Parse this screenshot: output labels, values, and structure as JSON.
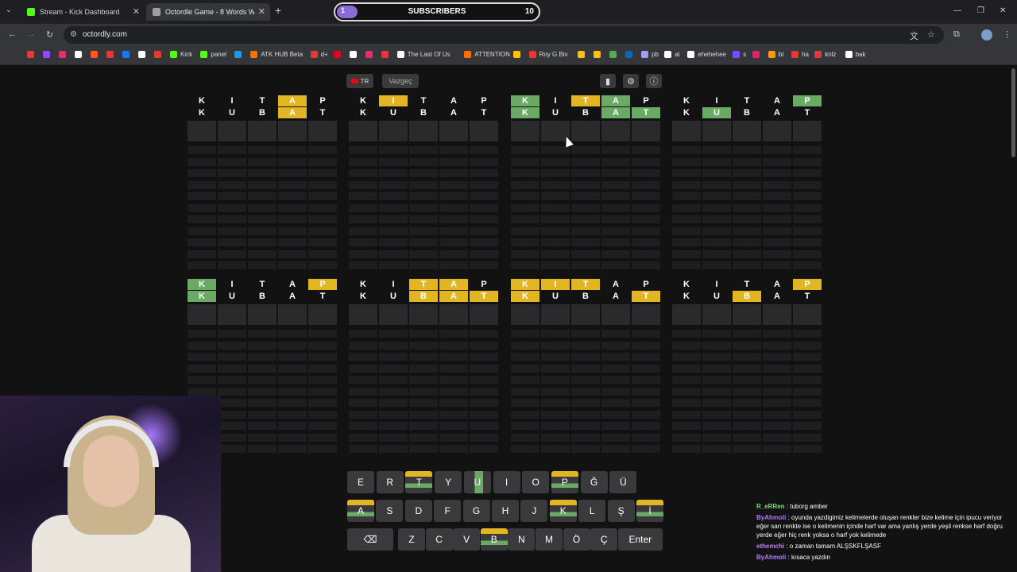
{
  "browser": {
    "tabs": [
      {
        "title": "Stream - Kick Dashboard",
        "favicon_color": "#53fc18"
      },
      {
        "title": "Octordle Game - 8 Words Wordle",
        "favicon_color": "#9e9e9e"
      }
    ],
    "url": "octordly.com",
    "bookmarks": [
      {
        "label": "",
        "color": "#e53935"
      },
      {
        "label": "",
        "color": "#9146ff"
      },
      {
        "label": "",
        "color": "#e1306c"
      },
      {
        "label": "",
        "color": "#ffffff"
      },
      {
        "label": "",
        "color": "#ff5722"
      },
      {
        "label": "",
        "color": "#e53935"
      },
      {
        "label": "",
        "color": "#1877f2"
      },
      {
        "label": "",
        "color": "#ffffff"
      },
      {
        "label": "",
        "color": "#e53935"
      },
      {
        "label": "Kick",
        "color": "#53fc18"
      },
      {
        "label": "panel",
        "color": "#53fc18"
      },
      {
        "label": "",
        "color": "#1b9aea"
      },
      {
        "label": "ATK HUB Beta",
        "color": "#ff6f00"
      },
      {
        "label": "d+",
        "color": "#e53935"
      },
      {
        "label": "",
        "color": "#e60023"
      },
      {
        "label": "",
        "color": "#ffffff"
      },
      {
        "label": "",
        "color": "#e1306c"
      },
      {
        "label": "",
        "color": "#e53935"
      },
      {
        "label": "The Last Of Us",
        "color": "#ffffff"
      },
      {
        "label": "ATTENTION",
        "color": "#ff6f00"
      },
      {
        "label": "",
        "color": "#ffc107"
      },
      {
        "label": "Roy G Biv",
        "color": "#e53935"
      },
      {
        "label": "",
        "color": "#ffc107"
      },
      {
        "label": "",
        "color": "#ffc107"
      },
      {
        "label": "",
        "color": "#4caf50"
      },
      {
        "label": "",
        "color": "#0a66c2"
      },
      {
        "label": "pb",
        "color": "#9e9eff"
      },
      {
        "label": "al",
        "color": "#ffffff"
      },
      {
        "label": "ehehehee",
        "color": "#ffffff"
      },
      {
        "label": "s",
        "color": "#7c4dff"
      },
      {
        "label": "",
        "color": "#e91e63"
      },
      {
        "label": "bt",
        "color": "#ff9800"
      },
      {
        "label": "ha",
        "color": "#e53935"
      },
      {
        "label": "knlz",
        "color": "#e53935"
      },
      {
        "label": "bak",
        "color": "#ffffff"
      }
    ]
  },
  "overlay": {
    "subscribers_label": "SUBSCRIBERS",
    "subscribers_current": "1",
    "subscribers_goal": "10",
    "subscribers_progress": 0.1
  },
  "header": {
    "lang_label": "TR",
    "giveup_label": "Vazgeç"
  },
  "colors": {
    "green": "#6aaa64",
    "yellow": "#e2b623",
    "empty": "#2a2a2c",
    "key": "#3a3a3c"
  },
  "boards": [
    {
      "rows": [
        [
          [
            "K",
            "n"
          ],
          [
            "I",
            "n"
          ],
          [
            "T",
            "n"
          ],
          [
            "A",
            "y"
          ],
          [
            "P",
            "n"
          ]
        ],
        [
          [
            "K",
            "n"
          ],
          [
            "U",
            "n"
          ],
          [
            "B",
            "n"
          ],
          [
            "A",
            "y"
          ],
          [
            "T",
            "n"
          ]
        ]
      ]
    },
    {
      "rows": [
        [
          [
            "K",
            "n"
          ],
          [
            "I",
            "y"
          ],
          [
            "T",
            "n"
          ],
          [
            "A",
            "n"
          ],
          [
            "P",
            "n"
          ]
        ],
        [
          [
            "K",
            "n"
          ],
          [
            "U",
            "n"
          ],
          [
            "B",
            "n"
          ],
          [
            "A",
            "n"
          ],
          [
            "T",
            "n"
          ]
        ]
      ]
    },
    {
      "rows": [
        [
          [
            "K",
            "g"
          ],
          [
            "I",
            "n"
          ],
          [
            "T",
            "y"
          ],
          [
            "A",
            "g"
          ],
          [
            "P",
            "n"
          ]
        ],
        [
          [
            "K",
            "g"
          ],
          [
            "U",
            "n"
          ],
          [
            "B",
            "n"
          ],
          [
            "A",
            "g"
          ],
          [
            "T",
            "g"
          ]
        ]
      ]
    },
    {
      "rows": [
        [
          [
            "K",
            "n"
          ],
          [
            "I",
            "n"
          ],
          [
            "T",
            "n"
          ],
          [
            "A",
            "n"
          ],
          [
            "P",
            "g"
          ]
        ],
        [
          [
            "K",
            "n"
          ],
          [
            "U",
            "g"
          ],
          [
            "B",
            "n"
          ],
          [
            "A",
            "n"
          ],
          [
            "T",
            "n"
          ]
        ]
      ]
    },
    {
      "rows": [
        [
          [
            "K",
            "g"
          ],
          [
            "I",
            "n"
          ],
          [
            "T",
            "n"
          ],
          [
            "A",
            "n"
          ],
          [
            "P",
            "y"
          ]
        ],
        [
          [
            "K",
            "g"
          ],
          [
            "U",
            "n"
          ],
          [
            "B",
            "n"
          ],
          [
            "A",
            "n"
          ],
          [
            "T",
            "n"
          ]
        ]
      ]
    },
    {
      "rows": [
        [
          [
            "K",
            "n"
          ],
          [
            "I",
            "n"
          ],
          [
            "T",
            "y"
          ],
          [
            "A",
            "y"
          ],
          [
            "P",
            "n"
          ]
        ],
        [
          [
            "K",
            "n"
          ],
          [
            "U",
            "n"
          ],
          [
            "B",
            "y"
          ],
          [
            "A",
            "y"
          ],
          [
            "T",
            "y"
          ]
        ]
      ]
    },
    {
      "rows": [
        [
          [
            "K",
            "y"
          ],
          [
            "I",
            "y"
          ],
          [
            "T",
            "y"
          ],
          [
            "A",
            "n"
          ],
          [
            "P",
            "n"
          ]
        ],
        [
          [
            "K",
            "y"
          ],
          [
            "U",
            "n"
          ],
          [
            "B",
            "n"
          ],
          [
            "A",
            "n"
          ],
          [
            "T",
            "y"
          ]
        ]
      ]
    },
    {
      "rows": [
        [
          [
            "K",
            "n"
          ],
          [
            "I",
            "n"
          ],
          [
            "T",
            "n"
          ],
          [
            "A",
            "n"
          ],
          [
            "P",
            "y"
          ]
        ],
        [
          [
            "K",
            "n"
          ],
          [
            "U",
            "n"
          ],
          [
            "B",
            "y"
          ],
          [
            "A",
            "n"
          ],
          [
            "T",
            "n"
          ]
        ]
      ]
    }
  ],
  "keyboard": {
    "row1": [
      {
        "k": "E",
        "s": "n"
      },
      {
        "k": "R",
        "s": "n"
      },
      {
        "k": "T",
        "s": "mix"
      },
      {
        "k": "Y",
        "s": "n"
      },
      {
        "k": "U",
        "s": "g"
      },
      {
        "k": "I",
        "s": "n"
      },
      {
        "k": "O",
        "s": "n"
      },
      {
        "k": "P",
        "s": "mix"
      },
      {
        "k": "Ğ",
        "s": "n"
      },
      {
        "k": "Ü",
        "s": "n"
      }
    ],
    "row2": [
      {
        "k": "A",
        "s": "mix"
      },
      {
        "k": "S",
        "s": "n"
      },
      {
        "k": "D",
        "s": "n"
      },
      {
        "k": "F",
        "s": "n"
      },
      {
        "k": "G",
        "s": "n"
      },
      {
        "k": "H",
        "s": "n"
      },
      {
        "k": "J",
        "s": "n"
      },
      {
        "k": "K",
        "s": "mix"
      },
      {
        "k": "L",
        "s": "n"
      },
      {
        "k": "Ş",
        "s": "n"
      },
      {
        "k": "İ",
        "s": "mix"
      }
    ],
    "row3": [
      {
        "k": "⌫",
        "s": "n"
      },
      {
        "k": "Z",
        "s": "n"
      },
      {
        "k": "C",
        "s": "n"
      },
      {
        "k": "V",
        "s": "n"
      },
      {
        "k": "B",
        "s": "mix"
      },
      {
        "k": "N",
        "s": "n"
      },
      {
        "k": "M",
        "s": "n"
      },
      {
        "k": "Ö",
        "s": "n"
      },
      {
        "k": "Ç",
        "s": "n"
      },
      {
        "k": "Enter",
        "s": "n"
      }
    ]
  },
  "chat": [
    {
      "user": "R_eRRen",
      "color": "#6ee36e",
      "text": "tuborg amber"
    },
    {
      "user": "ByAhmoli",
      "color": "#b17cff",
      "text": "oyunda yazdigimiz kelimelerde oluşan renkler bize kelime için ipucu veriyor eğer sarı renkte ise o kelimenin içinde harf var ama yanlış yerde yeşil renkse harf doğru yerde eğer hiç renk yoksa o harf yok kelimede"
    },
    {
      "user": "ethemchi",
      "color": "#c97cff",
      "text": "o zaman tamam ALŞSKFLŞASF"
    },
    {
      "user": "ByAhmoli",
      "color": "#b17cff",
      "text": "kısaca yazdın"
    }
  ]
}
